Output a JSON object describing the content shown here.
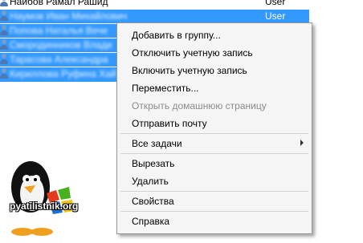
{
  "rows": [
    {
      "name": "Наибов Рамал Рашид",
      "type": "User",
      "selected": false
    },
    {
      "name": "Наумов Иван Михайлович",
      "type": "User",
      "selected": true
    },
    {
      "name": "Попова Наталья Вече",
      "type": "",
      "selected": true
    },
    {
      "name": "Смородинников Влади",
      "type": "",
      "selected": true
    },
    {
      "name": "Тарасова Александра",
      "type": "",
      "selected": true
    },
    {
      "name": "Кириллова Руфина Хай",
      "type": "",
      "selected": true
    }
  ],
  "menu": {
    "add_to_group": "Добавить в группу...",
    "disable_account": "Отключить учетную запись",
    "enable_account": "Включить учетную запись",
    "move": "Переместить...",
    "open_home_page": "Открыть домашнюю страницу",
    "send_mail": "Отправить почту",
    "all_tasks": "Все задачи",
    "cut": "Вырезать",
    "delete": "Удалить",
    "properties": "Свойства",
    "help": "Справка"
  },
  "watermark": {
    "text": "pyatilistnik.org"
  },
  "colors": {
    "selection": "#3399ff",
    "menu_bg": "#f5f5f5",
    "disabled_text": "#8c8c8c"
  }
}
